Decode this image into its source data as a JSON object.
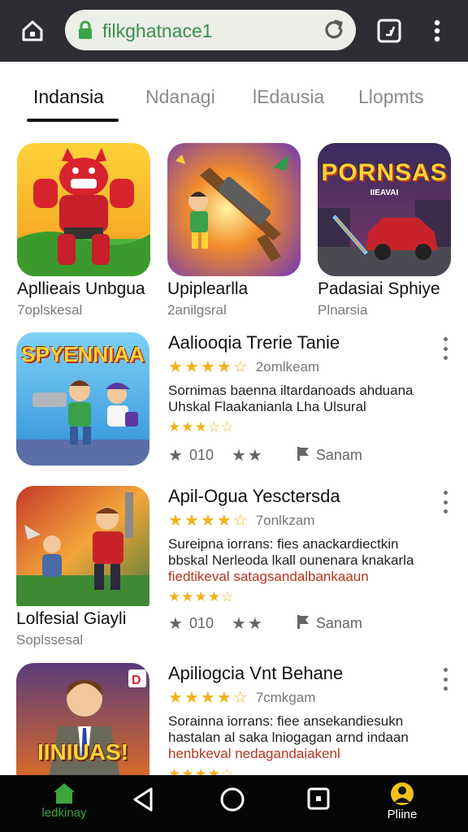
{
  "browser": {
    "url": "filkghatnace1",
    "home_icon": "home-icon",
    "reload_icon": "reload-icon",
    "tabs_icon": "tab-switcher-icon",
    "menu_icon": "kebab-menu-icon"
  },
  "tabs": [
    {
      "label": "Indansia",
      "active": true
    },
    {
      "label": "Ndanagi",
      "active": false
    },
    {
      "label": "lEdausia",
      "active": false
    },
    {
      "label": "Llopmts",
      "active": false
    }
  ],
  "featured": [
    {
      "title": "Apllieais Unbgua",
      "subtitle": "7oplskesal"
    },
    {
      "title": "Upiplearlla",
      "subtitle": "2anilgsral"
    },
    {
      "title": "Padasiai Sphiye",
      "subtitle": "Plnarsia",
      "art_text": "PORNSAS",
      "art_small": "IIEAVAI"
    }
  ],
  "list": [
    {
      "art_text": "SPYENNIAA",
      "title": "Aaliooqia Trerie Tanie",
      "rating": 4.5,
      "count": "2omlkeam",
      "desc1": "Sornimas baenna iltardanoads ahduana",
      "desc2": "Uhskal Flaakanianla Lha Ulsural",
      "desc_red": "",
      "small_rating": 3.5,
      "meta_left": "010",
      "meta_right": "Sanam",
      "under_title": "",
      "under_sub": ""
    },
    {
      "art_text": "",
      "title": "Apil-Ogua Yesctersda",
      "rating": 4.5,
      "count": "7onlkzam",
      "desc1": "Sureipna iorrans: fies anackardiectkin",
      "desc2": "bbskal Nerleoda lkall ounenara knakarla",
      "desc_red": "fiedtikeval satagsandalbankaaun",
      "small_rating": 4.5,
      "meta_left": "010",
      "meta_right": "Sanam",
      "under_title": "Lolfesial Giayli",
      "under_sub": "Soplssesal"
    },
    {
      "art_text": "IINIUAS!",
      "title": "Apiliogcia Vnt Behane",
      "rating": 4.5,
      "count": "7cmkgam",
      "desc1": "Sorainna iorrans: fiee ansekandiesukn",
      "desc2": "hastalan al saka lniogagan arnd indaan",
      "desc_red": "henbkeval nedagandaiakenl",
      "small_rating": 4.5,
      "meta_left": "",
      "meta_right": "",
      "under_title": "",
      "under_sub": ""
    }
  ],
  "nav": {
    "home_label": "ledkinay",
    "profile_label": "Pliine",
    "home_color": "#3ca63c",
    "profile_color": "#f2c21a"
  }
}
